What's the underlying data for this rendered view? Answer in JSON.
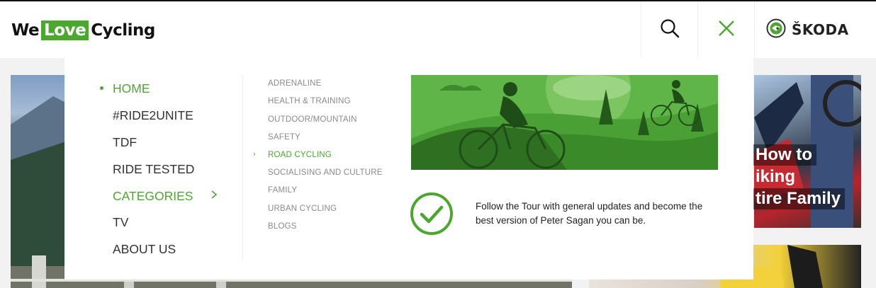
{
  "header": {
    "logo": {
      "part1": "We",
      "part2": "Love",
      "part3": "Cycling"
    },
    "brand": "ŠKODA",
    "search_icon": "search-icon",
    "close_icon": "close-icon",
    "brand_icon": "skoda-logo-icon"
  },
  "menu": {
    "primary": [
      {
        "label": "HOME",
        "active": true
      },
      {
        "label": "#RIDE2UNITE",
        "active": false
      },
      {
        "label": "TDF",
        "active": false
      },
      {
        "label": "RIDE TESTED",
        "active": false
      },
      {
        "label": "CATEGORIES",
        "active": true,
        "has_submenu": true
      },
      {
        "label": "TV",
        "active": false
      },
      {
        "label": "ABOUT US",
        "active": false
      }
    ],
    "categories": [
      {
        "label": "ADRENALINE",
        "active": false
      },
      {
        "label": "HEALTH & TRAINING",
        "active": false
      },
      {
        "label": "OUTDOOR/MOUNTAIN",
        "active": false
      },
      {
        "label": "SAFETY",
        "active": false
      },
      {
        "label": "ROAD CYCLING",
        "active": true
      },
      {
        "label": "SOCIALISING AND CULTURE",
        "active": false
      },
      {
        "label": "FAMILY",
        "active": false
      },
      {
        "label": "URBAN CYCLING",
        "active": false
      },
      {
        "label": "BLOGS",
        "active": false
      }
    ],
    "feature": {
      "image": "road-cycling-illustration",
      "check_icon": "check-circle-icon",
      "description": "Follow the Tour with general updates and become the best version of Peter Sagan you can be."
    }
  },
  "background": {
    "article_title_lines": [
      "How to",
      "iking",
      "tire Family"
    ]
  },
  "colors": {
    "accent": "#4ba82e",
    "text": "#333333",
    "muted": "#8a8a8a"
  }
}
